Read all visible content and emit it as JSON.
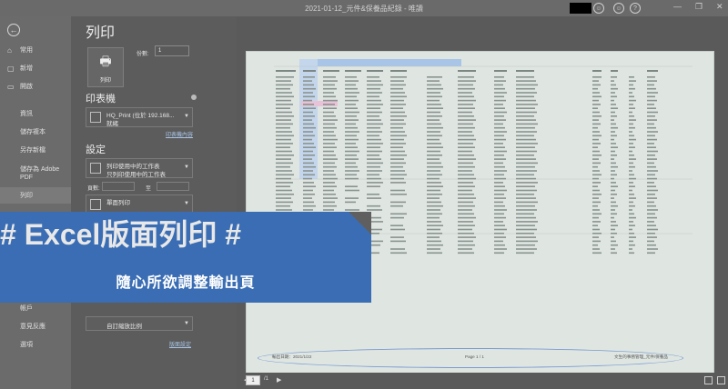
{
  "window": {
    "title": "2021-01-12_元件&保養品紀錄 - 唯讀"
  },
  "nav": {
    "items": [
      {
        "label": "常用",
        "icon": "home-icon"
      },
      {
        "label": "新增",
        "icon": "new-file-icon"
      },
      {
        "label": "開啟",
        "icon": "folder-icon"
      },
      {
        "label": "資訊"
      },
      {
        "label": "儲存複本"
      },
      {
        "label": "另存新檔"
      },
      {
        "label": "儲存為 Adobe PDF"
      },
      {
        "label": "列印"
      },
      {
        "label": "帳戶"
      },
      {
        "label": "意見反應"
      },
      {
        "label": "選項"
      }
    ],
    "selected": "列印"
  },
  "print": {
    "title": "列印",
    "button_label": "列印",
    "copies_label": "份數:",
    "copies_value": "1"
  },
  "printer": {
    "heading": "印表機",
    "name": "HQ_Print (位於 192.168...",
    "status": "就緒",
    "properties_link": "印表機內容"
  },
  "settings": {
    "heading": "設定",
    "scope_line1": "列印使用中的工作表",
    "scope_line2": "只列印使用中的工作表",
    "pages_label": "頁數:",
    "pages_to": "至",
    "collate_line1": "單面列印",
    "scaling": "自訂縮放比例",
    "page_setup_link": "版面設定"
  },
  "preview": {
    "footer_left": "輸出日期：2021/1/22",
    "footer_center": "Page 1 / 1",
    "footer_right": "文生的事務管理_元件/保養品",
    "page_current": "1",
    "page_total": "/1"
  },
  "banner": {
    "title": "# Excel版面列印 #",
    "subtitle": "隨心所欲調整輸出頁"
  }
}
